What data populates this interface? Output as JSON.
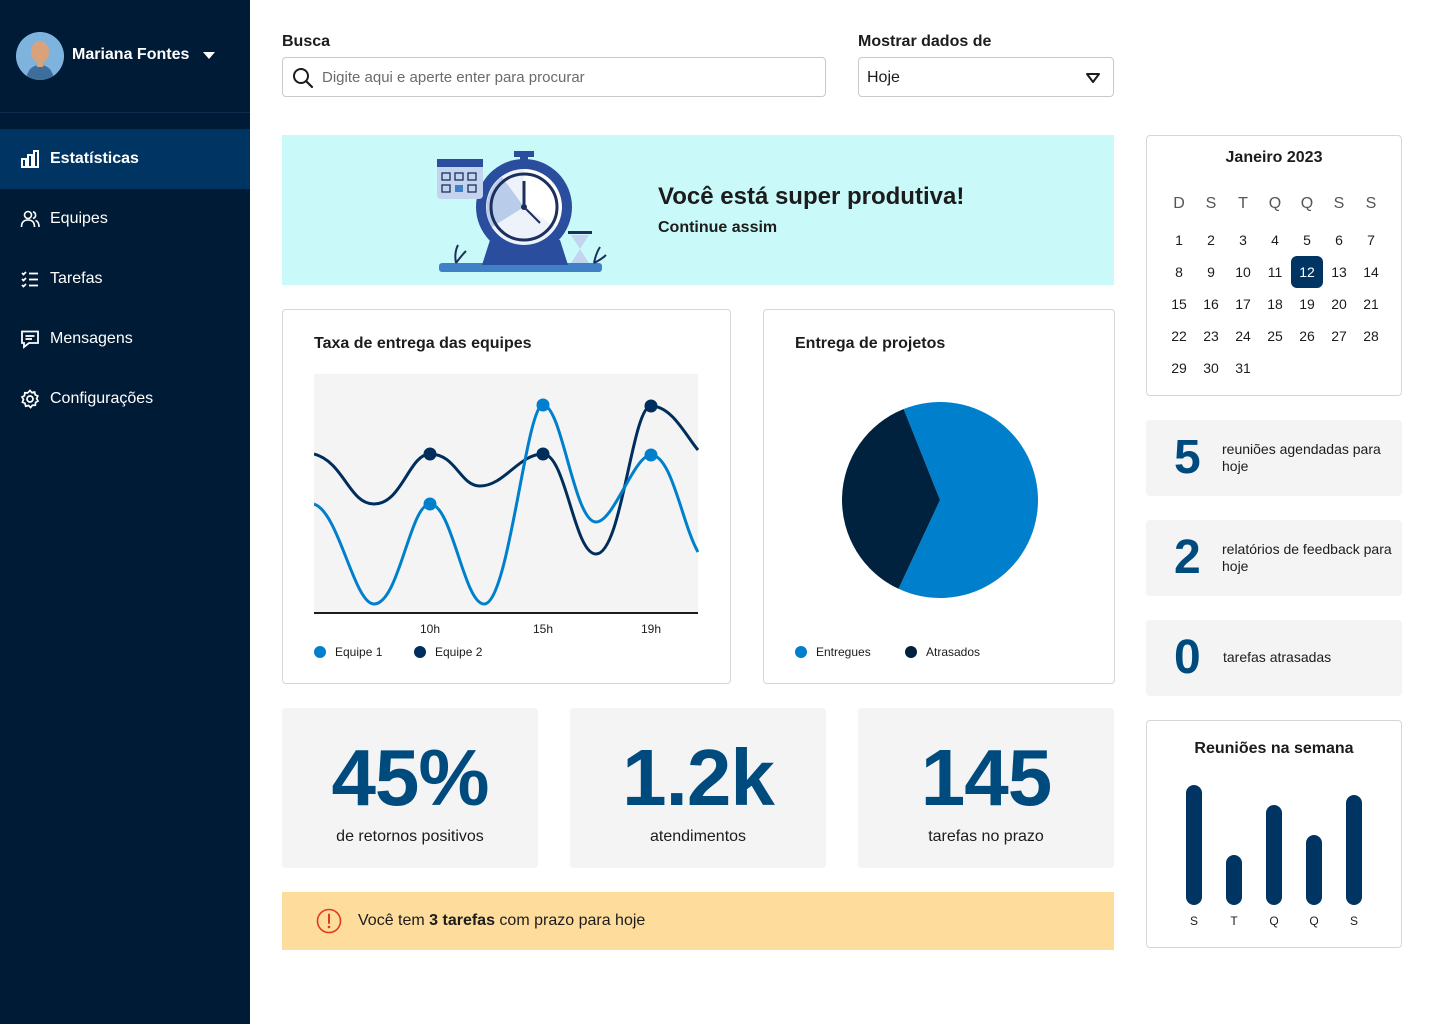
{
  "user": {
    "name": "Mariana Fontes"
  },
  "nav": [
    {
      "label": "Estatísticas",
      "icon": "bar-chart-icon",
      "active": true
    },
    {
      "label": "Equipes",
      "icon": "users-icon",
      "active": false
    },
    {
      "label": "Tarefas",
      "icon": "checklist-icon",
      "active": false
    },
    {
      "label": "Mensagens",
      "icon": "message-icon",
      "active": false
    },
    {
      "label": "Configurações",
      "icon": "gear-icon",
      "active": false
    }
  ],
  "search": {
    "label": "Busca",
    "placeholder": "Digite aqui e aperte enter para procurar",
    "value": ""
  },
  "filter": {
    "label": "Mostrar dados de",
    "value": "Hoje"
  },
  "banner": {
    "title": "Você está super produtiva!",
    "subtitle": "Continue assim"
  },
  "delivery_rate": {
    "title": "Taxa de entrega das equipes",
    "legend": [
      {
        "label": "Equipe 1",
        "color": "#0080cc"
      },
      {
        "label": "Equipe 2",
        "color": "#002e5c"
      }
    ]
  },
  "projects": {
    "title": "Entrega de projetos",
    "legend": [
      {
        "label": "Entregues",
        "color": "#0080cc"
      },
      {
        "label": "Atrasados",
        "color": "#00223e"
      }
    ]
  },
  "kpis": [
    {
      "value": "45%",
      "caption": "de retornos positivos"
    },
    {
      "value": "1.2k",
      "caption": "atendimentos"
    },
    {
      "value": "145",
      "caption": "tarefas no prazo"
    }
  ],
  "alert": {
    "prefix": "Você tem ",
    "bold": "3 tarefas",
    "suffix": " com prazo para hoje"
  },
  "calendar": {
    "title": "Janeiro 2023",
    "weekdays": [
      "D",
      "S",
      "T",
      "Q",
      "Q",
      "S",
      "S"
    ],
    "start_weekday": 0,
    "days": 31,
    "selected": 12
  },
  "stats": [
    {
      "value": "5",
      "text": "reuniões agendadas para hoje"
    },
    {
      "value": "2",
      "text": "relatórios de feedback para hoje"
    },
    {
      "value": "0",
      "text": "tarefas atrasadas"
    }
  ],
  "chart_data": [
    {
      "type": "line",
      "title": "Taxa de entrega das equipes",
      "x_ticks": [
        "10h",
        "15h",
        "19h"
      ],
      "series": [
        {
          "name": "Equipe 1",
          "marked_points": [
            {
              "x": "10h",
              "y": 0.55
            },
            {
              "x": "15h",
              "y": 1.0
            },
            {
              "x": "19h",
              "y": 0.8
            }
          ]
        },
        {
          "name": "Equipe 2",
          "marked_points": [
            {
              "x": "10h",
              "y": 0.8
            },
            {
              "x": "15h",
              "y": 0.8
            },
            {
              "x": "19h",
              "y": 1.0
            }
          ]
        }
      ],
      "legend_position": "bottom-left"
    },
    {
      "type": "pie",
      "title": "Entrega de projetos",
      "categories": [
        "Entregues",
        "Atrasados"
      ],
      "values": [
        63,
        37
      ],
      "colors": [
        "#0080cc",
        "#00223e"
      ]
    },
    {
      "type": "bar",
      "title": "Reuniões na semana",
      "categories": [
        "S",
        "T",
        "Q",
        "Q",
        "S"
      ],
      "values": [
        6,
        2.5,
        5,
        3.5,
        5.5
      ],
      "color": "#003563"
    }
  ]
}
